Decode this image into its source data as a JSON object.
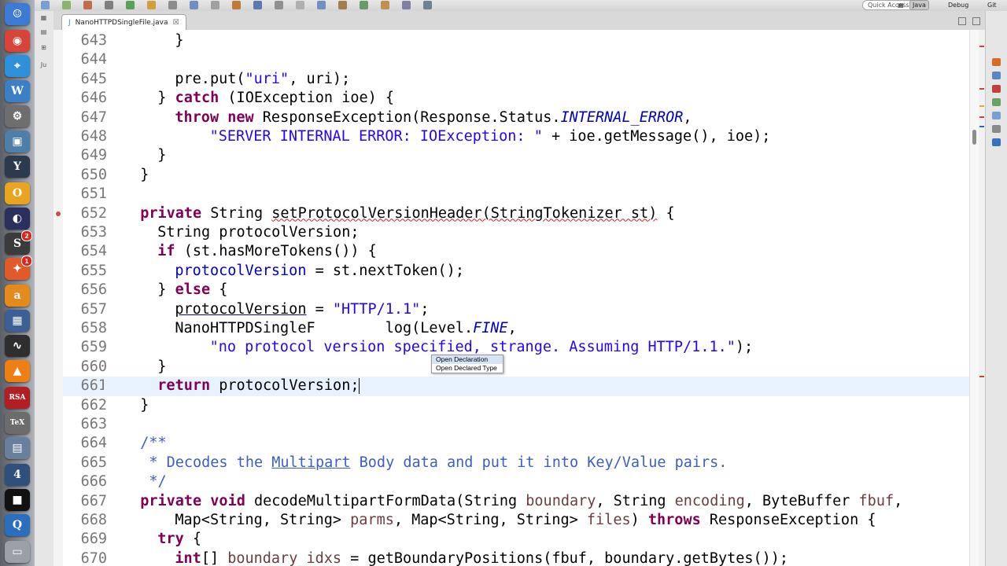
{
  "toolbar": {
    "quick_access_placeholder": "Quick Access",
    "perspectives": [
      {
        "label": "Java",
        "active": true
      },
      {
        "label": "Debug",
        "active": false
      },
      {
        "label": "Git",
        "active": false
      }
    ]
  },
  "editor_tab": {
    "title": "NanoHTTPDSingleFile.java",
    "close_glyph": "☒"
  },
  "dock": [
    {
      "name": "finder-icon",
      "glyph": "☺",
      "color": "#3b7bd6"
    },
    {
      "name": "chrome-icon",
      "glyph": "◉",
      "color": "#d9443a"
    },
    {
      "name": "safari-icon",
      "glyph": "⌖",
      "color": "#2f8fd8"
    },
    {
      "name": "wunderlist-icon",
      "glyph": "W",
      "color": "#3c7fc4"
    },
    {
      "name": "system-preferences-icon",
      "glyph": "⚙",
      "color": "#6e6e6e"
    },
    {
      "name": "preview-icon",
      "glyph": "▣",
      "color": "#4e7fa8"
    },
    {
      "name": "yoink-icon",
      "glyph": "Y",
      "color": "#2c3a4d"
    },
    {
      "name": "oo-icon",
      "glyph": "O",
      "color": "#e8a520"
    },
    {
      "name": "eclipse-icon",
      "glyph": "◐",
      "color": "#2b2f5e"
    },
    {
      "name": "slack-icon",
      "glyph": "S",
      "color": "#3b3b3b",
      "badge": "2"
    },
    {
      "name": "hangouts-icon",
      "glyph": "✦",
      "color": "#e05a2a",
      "badge": "1"
    },
    {
      "name": "amazon-icon",
      "glyph": "a",
      "color": "#e48b1e"
    },
    {
      "name": "virtualbox-icon",
      "glyph": "▦",
      "color": "#3d5f94"
    },
    {
      "name": "activity-monitor-icon",
      "glyph": "∿",
      "color": "#2e2e2e"
    },
    {
      "name": "vlc-icon",
      "glyph": "▲",
      "color": "#f07f13"
    },
    {
      "name": "rsa-securid-icon",
      "glyph": "RSA",
      "color": "#b21e24"
    },
    {
      "name": "tex-icon",
      "glyph": "TeX",
      "color": "#6c6c6c"
    },
    {
      "name": "image-capture-icon",
      "glyph": "▤",
      "color": "#6a7f9c"
    },
    {
      "name": "calendar-4-icon",
      "glyph": "4",
      "color": "#30507c"
    },
    {
      "name": "terminal-icon",
      "glyph": "■",
      "color": "#111111"
    },
    {
      "name": "quicktime-icon",
      "glyph": "Q",
      "color": "#2a6ebd"
    },
    {
      "name": "trash-icon",
      "glyph": "▭",
      "color": "#9aa0a6"
    }
  ],
  "lines": [
    {
      "n": "643",
      "indent": 8,
      "tokens": [
        [
          "",
          "}"
        ]
      ]
    },
    {
      "n": "644",
      "indent": 0,
      "tokens": []
    },
    {
      "n": "645",
      "indent": 8,
      "tokens": [
        [
          "",
          "pre.put("
        ],
        [
          "str",
          "\"uri\""
        ],
        [
          "",
          ", uri);"
        ]
      ]
    },
    {
      "n": "646",
      "indent": 6,
      "tokens": [
        [
          "",
          "} "
        ],
        [
          "kw",
          "catch"
        ],
        [
          "",
          " (IOException ioe) {"
        ]
      ]
    },
    {
      "n": "647",
      "indent": 8,
      "tokens": [
        [
          "kw",
          "throw"
        ],
        [
          "",
          " "
        ],
        [
          "kw",
          "new"
        ],
        [
          "",
          " ResponseException(Response.Status."
        ],
        [
          "sfld",
          "INTERNAL_ERROR"
        ],
        [
          "",
          ","
        ]
      ]
    },
    {
      "n": "648",
      "indent": 12,
      "tokens": [
        [
          "str",
          "\"SERVER INTERNAL ERROR: IOException: \""
        ],
        [
          "",
          " + ioe.getMessage(), ioe);"
        ]
      ]
    },
    {
      "n": "649",
      "indent": 6,
      "tokens": [
        [
          "",
          "}"
        ]
      ]
    },
    {
      "n": "650",
      "indent": 4,
      "tokens": [
        [
          "",
          "}"
        ]
      ]
    },
    {
      "n": "651",
      "indent": 0,
      "tokens": []
    },
    {
      "n": "652",
      "indent": 4,
      "tokens": [
        [
          "kw",
          "private"
        ],
        [
          "",
          " String "
        ],
        [
          "warn",
          "setProtocolVersionHeader(StringTokenizer st)"
        ],
        [
          "",
          " {"
        ]
      ]
    },
    {
      "n": "653",
      "indent": 6,
      "tokens": [
        [
          "",
          "String protocolVersion;"
        ]
      ]
    },
    {
      "n": "654",
      "indent": 6,
      "tokens": [
        [
          "kw",
          "if"
        ],
        [
          "",
          " (st.hasMoreTokens()) {"
        ]
      ]
    },
    {
      "n": "655",
      "indent": 8,
      "tokens": [
        [
          "fld",
          "protocolVersion"
        ],
        [
          "",
          " = st.nextToken();"
        ]
      ]
    },
    {
      "n": "656",
      "indent": 6,
      "tokens": [
        [
          "",
          "} "
        ],
        [
          "kw",
          "else"
        ],
        [
          "",
          " {"
        ]
      ]
    },
    {
      "n": "657",
      "indent": 8,
      "tokens": [
        [
          "und",
          "protocolVersion"
        ],
        [
          "",
          " = "
        ],
        [
          "str",
          "\"HTTP/1.1\""
        ],
        [
          "",
          ";"
        ]
      ]
    },
    {
      "n": "658",
      "indent": 8,
      "tokens": [
        [
          "",
          "NanoHTTPDSingleF"
        ],
        [
          "",
          " "
        ],
        [
          "",
          "       log(Level."
        ],
        [
          "sfld",
          "FINE"
        ],
        [
          "",
          ","
        ]
      ]
    },
    {
      "n": "659",
      "indent": 12,
      "tokens": [
        [
          "str",
          "\"no protocol version specified, strange. Assuming HTTP/1.1.\""
        ],
        [
          "",
          ");"
        ]
      ]
    },
    {
      "n": "660",
      "indent": 6,
      "tokens": [
        [
          "",
          "}"
        ]
      ]
    },
    {
      "n": "661",
      "indent": 6,
      "tokens": [
        [
          "kw",
          "return"
        ],
        [
          "",
          " protocolVersion;"
        ],
        [
          "caret",
          ""
        ]
      ],
      "current": true
    },
    {
      "n": "662",
      "indent": 4,
      "tokens": [
        [
          "",
          "}"
        ]
      ]
    },
    {
      "n": "663",
      "indent": 0,
      "tokens": []
    },
    {
      "n": "664",
      "indent": 4,
      "tokens": [
        [
          "cmt",
          "/**"
        ]
      ]
    },
    {
      "n": "665",
      "indent": 4,
      "tokens": [
        [
          "cmt",
          " * Decodes the "
        ],
        [
          "cmtu",
          "Multipart"
        ],
        [
          "cmt",
          " Body data and put it into Key/Value pairs."
        ]
      ]
    },
    {
      "n": "666",
      "indent": 4,
      "tokens": [
        [
          "cmt",
          " */"
        ]
      ]
    },
    {
      "n": "667",
      "indent": 4,
      "tokens": [
        [
          "kw",
          "private"
        ],
        [
          "",
          " "
        ],
        [
          "kw",
          "void"
        ],
        [
          "",
          " decodeMultipartFormData(String "
        ],
        [
          "par",
          "boundary"
        ],
        [
          "",
          ", String "
        ],
        [
          "par",
          "encoding"
        ],
        [
          "",
          ", ByteBuffer "
        ],
        [
          "par",
          "fbuf"
        ],
        [
          "",
          ","
        ]
      ]
    },
    {
      "n": "668",
      "indent": 8,
      "tokens": [
        [
          "",
          "Map<String, String> "
        ],
        [
          "par",
          "parms"
        ],
        [
          "",
          ", Map<String, String> "
        ],
        [
          "par",
          "files"
        ],
        [
          "",
          ") "
        ],
        [
          "kw",
          "throws"
        ],
        [
          "",
          " ResponseException {"
        ]
      ]
    },
    {
      "n": "669",
      "indent": 6,
      "tokens": [
        [
          "kw",
          "try"
        ],
        [
          "",
          " {"
        ]
      ]
    },
    {
      "n": "670",
      "indent": 8,
      "tokens": [
        [
          "kw",
          "int"
        ],
        [
          "",
          "[] "
        ],
        [
          "par",
          "boundary_idxs"
        ],
        [
          "",
          " = getBoundaryPositions(fbuf, boundary.getBytes());"
        ]
      ]
    }
  ],
  "popup": {
    "items": [
      "Open Declaration",
      "Open Declared Type"
    ]
  }
}
